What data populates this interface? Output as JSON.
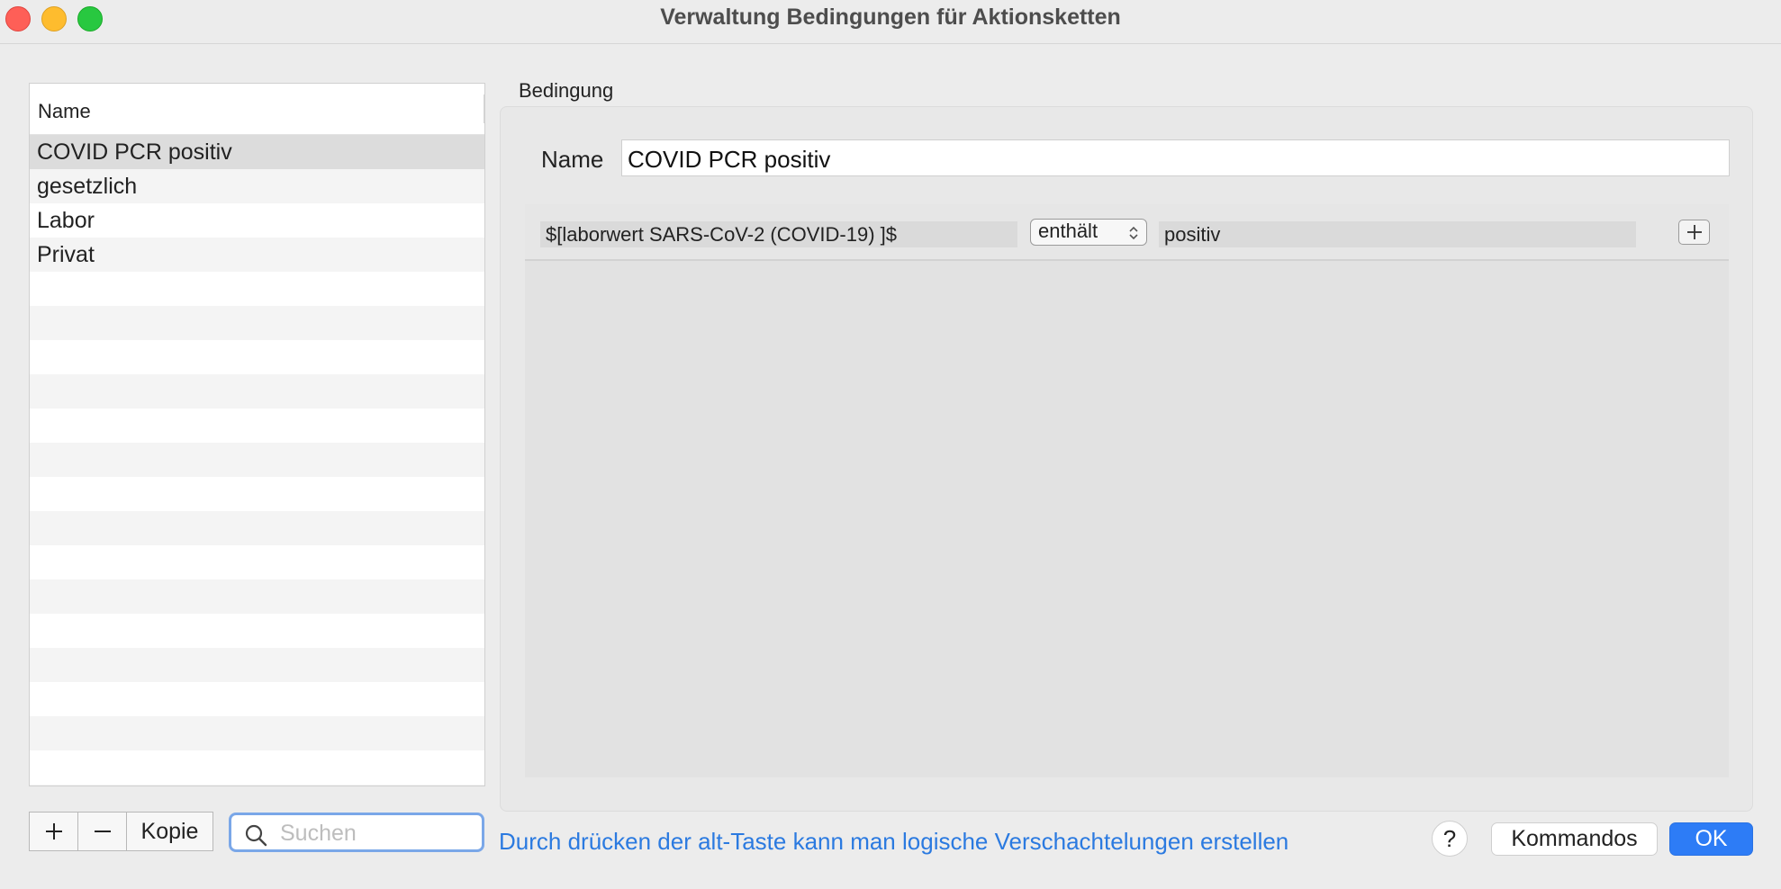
{
  "window": {
    "title": "Verwaltung Bedingungen für Aktionsketten"
  },
  "list": {
    "header": "Name",
    "items": [
      {
        "label": "COVID PCR positiv",
        "selected": true
      },
      {
        "label": "gesetzlich",
        "selected": false
      },
      {
        "label": "Labor",
        "selected": false
      },
      {
        "label": "Privat",
        "selected": false
      }
    ]
  },
  "list_controls": {
    "add_icon": "plus-icon",
    "remove_icon": "minus-icon",
    "copy_label": "Kopie",
    "search_placeholder": "Suchen"
  },
  "condition": {
    "group_label": "Bedingung",
    "name_label": "Name",
    "name_value": "COVID PCR positiv",
    "rows": [
      {
        "variable": "$[laborwert SARS-CoV-2 (COVID-19) ]$",
        "operator": "enthält",
        "value": "positiv"
      }
    ]
  },
  "footer": {
    "hint": "Durch drücken der alt-Taste kann man logische Verschachtelungen erstellen",
    "help_label": "?",
    "commands_label": "Kommandos",
    "ok_label": "OK"
  },
  "colors": {
    "accent": "#2d7cf6",
    "hint_text": "#2b7ae0"
  }
}
